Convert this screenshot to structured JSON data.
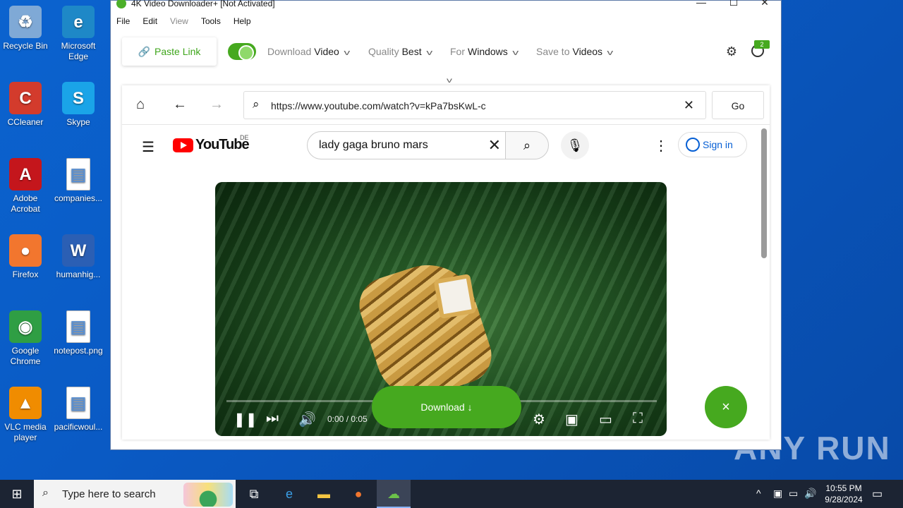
{
  "desktop": {
    "icons": [
      {
        "name": "recycle-bin",
        "label": "Recycle Bin",
        "glyph": "♻",
        "color": "#7fa9d6"
      },
      {
        "name": "microsoft-edge",
        "label": "Microsoft Edge",
        "glyph": "e",
        "color": "#1e88c7"
      },
      {
        "name": "ccleaner",
        "label": "CCleaner",
        "glyph": "C",
        "color": "#d33b2c"
      },
      {
        "name": "skype",
        "label": "Skype",
        "glyph": "S",
        "color": "#1aa4e8"
      },
      {
        "name": "adobe-acrobat",
        "label": "Adobe Acrobat",
        "glyph": "A",
        "color": "#c4161c"
      },
      {
        "name": "companies",
        "label": "companies...",
        "glyph": "",
        "color": "#ffffff"
      },
      {
        "name": "firefox",
        "label": "Firefox",
        "glyph": "●",
        "color": "#f2762e"
      },
      {
        "name": "humanhig",
        "label": "humanhig...",
        "glyph": "W",
        "color": "#2b5fb4"
      },
      {
        "name": "google-chrome",
        "label": "Google Chrome",
        "glyph": "◉",
        "color": "#2f9e44"
      },
      {
        "name": "notepost",
        "label": "notepost.png",
        "glyph": "",
        "color": "#ffffff"
      },
      {
        "name": "vlc",
        "label": "VLC media player",
        "glyph": "▲",
        "color": "#f08c00"
      },
      {
        "name": "pacificwoul",
        "label": "pacificwoul...",
        "glyph": "",
        "color": "#ffffff"
      }
    ],
    "watermark": "ANY RUN"
  },
  "app": {
    "title": "4K Video Downloader+ [Not Activated]",
    "menu": [
      "File",
      "Edit",
      "View",
      "Tools",
      "Help"
    ],
    "toolbar": {
      "paste_link": "Paste Link",
      "download_label": "Download",
      "download_value": "Video",
      "quality_label": "Quality",
      "quality_value": "Best",
      "for_label": "For",
      "for_value": "Windows",
      "save_label": "Save to",
      "save_value": "Videos",
      "account_badge": "2"
    },
    "browser": {
      "url": "https://www.youtube.com/watch?v=kPa7bsKwL-c",
      "go_label": "Go"
    },
    "youtube": {
      "logo_text": "YouTube",
      "country": "DE",
      "search_query": "lady gaga bruno mars",
      "sign_in": "Sign in",
      "video_time": "0:00 / 0:05"
    },
    "download_button": "Download ↓",
    "close_fab": "×"
  },
  "taskbar": {
    "search_placeholder": "Type here to search",
    "time": "10:55 PM",
    "date": "9/28/2024"
  }
}
